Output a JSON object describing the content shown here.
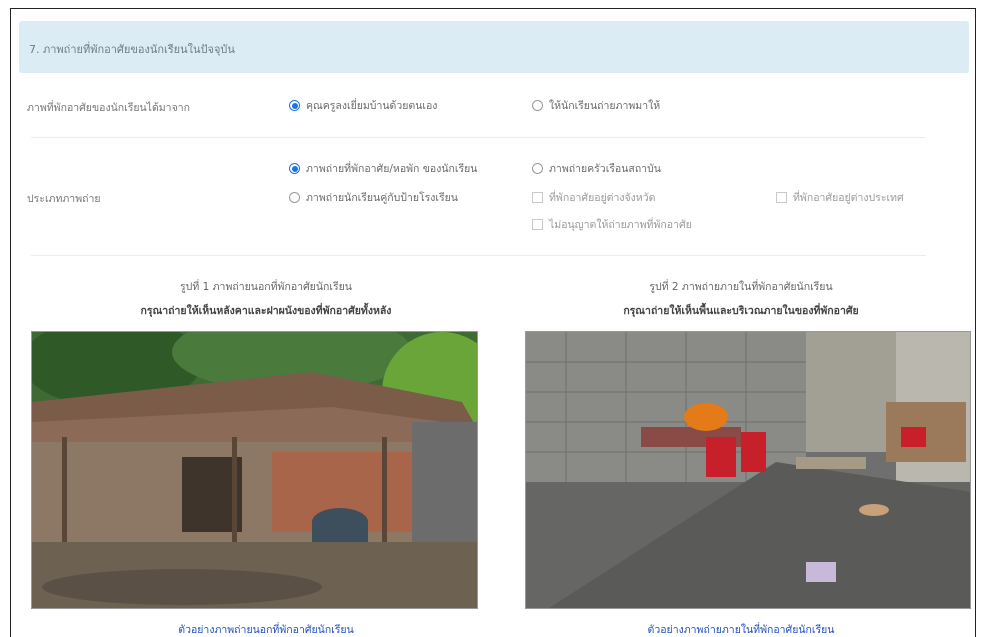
{
  "section": {
    "title": "7. ภาพถ่ายที่พักอาศัยของนักเรียนในปัจจุบัน"
  },
  "photo_source": {
    "label": "ภาพที่พักอาศัยของนักเรียนได้มาจาก",
    "options": [
      {
        "label": "คุณครูลงเยี่ยมบ้านด้วยตนเอง",
        "selected": true
      },
      {
        "label": "ให้นักเรียนถ่ายภาพมาให้",
        "selected": false
      }
    ]
  },
  "photo_type": {
    "label": "ประเภทภาพถ่าย",
    "radios": [
      {
        "label": "ภาพถ่ายที่พักอาศัย/หอพัก ของนักเรียน",
        "selected": true
      },
      {
        "label": "ภาพถ่ายนักเรียนคู่กับป้ายโรงเรียน",
        "selected": false
      },
      {
        "label": "ภาพถ่ายครัวเรือนสถาบัน",
        "selected": false
      }
    ],
    "checkboxes": [
      {
        "label": "ที่พักอาศัยอยู่ต่างจังหวัด",
        "checked": false
      },
      {
        "label": "ที่พักอาศัยอยู่ต่างประเทศ",
        "checked": false
      },
      {
        "label": "ไม่อนุญาตให้ถ่ายภาพที่พักอาศัย",
        "checked": false
      }
    ]
  },
  "pictures": [
    {
      "title": "รูปที่ 1 ภาพถ่ายนอกที่พักอาศัยนักเรียน",
      "subtitle": "กรุณาถ่ายให้เห็นหลังคาและฝาผนังของที่พักอาศัยทั้งหลัง",
      "link": "ตัวอย่างภาพถ่ายนอกที่พักอาศัยนักเรียน"
    },
    {
      "title": "รูปที่ 2 ภาพถ่ายภายในที่พักอาศัยนักเรียน",
      "subtitle": "กรุณาถ่ายให้เห็นพื้นและบริเวณภายในของที่พักอาศัย",
      "link": "ตัวอย่างภาพถ่ายภายในที่พักอาศัยนักเรียน"
    }
  ],
  "colors": {
    "header_bg": "#dcecf5",
    "accent": "#1a73e8",
    "link": "#1f4fbf"
  }
}
